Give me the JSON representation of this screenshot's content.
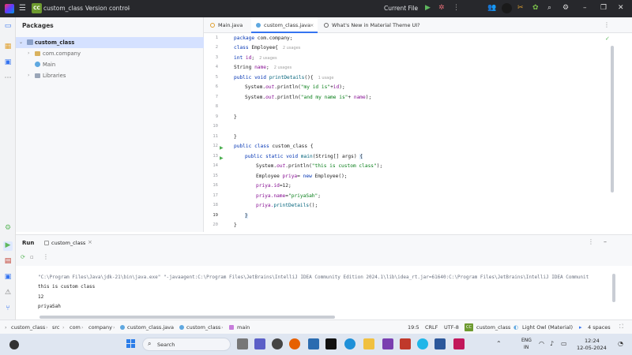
{
  "titlebar": {
    "project_badge": "CC",
    "project_name": "custom_class",
    "vcs": "Version control",
    "run_config": "Current File"
  },
  "project_panel": {
    "header": "Packages",
    "tree": [
      {
        "label": "custom_class",
        "depth": 0,
        "selected": true
      },
      {
        "label": "com.company",
        "depth": 1
      },
      {
        "label": "Main",
        "depth": 1
      },
      {
        "label": "Libraries",
        "depth": 1
      }
    ]
  },
  "tabs": [
    {
      "label": "Main.java"
    },
    {
      "label": "custom_class.java",
      "active": true
    },
    {
      "label": "What's New in Material Theme UI?"
    }
  ],
  "editor": {
    "line_numbers": [
      "1",
      "2",
      "3",
      "4",
      "5",
      "6",
      "7",
      "8",
      "9",
      "10",
      "11",
      "12",
      "13",
      "14",
      "15",
      "16",
      "17",
      "18",
      "19",
      "20"
    ],
    "hints": {
      "h2": "2 usages",
      "h3": "2 usages",
      "h4": "2 usages",
      "h5": "1 usage"
    },
    "code": {
      "l1_kw": "package",
      "l1_rest": " com.company;",
      "l2_kw": "class",
      "l2_rest": " Employee{",
      "l3_kw": "int",
      "l3_fld": " id",
      "l3_rest": ";",
      "l4_rest": "String ",
      "l4_fld": "name",
      "l4_end": ";",
      "l5_kw": "public void",
      "l5_fn": " printDetails",
      "l5_rest": "(){",
      "l6_a": "System.",
      "l6_b": "out",
      "l6_c": ".println(",
      "l6_str": "\"my id is\"",
      "l6_d": "+",
      "l6_fld": "id",
      "l6_e": ");",
      "l7_a": "System.",
      "l7_b": "out",
      "l7_c": ".println(",
      "l7_str": "\"and my name is\"",
      "l7_d": "+ ",
      "l7_fld": "name",
      "l7_e": ");",
      "l9": "}",
      "l11": "}",
      "l12_kw": "public class",
      "l12_rest": " custom_class {",
      "l13_kw": "public static void",
      "l13_fn": " main",
      "l13_rest": "(String[] args) ",
      "l13_brace": "{",
      "l14_a": "System.",
      "l14_b": "out",
      "l14_c": ".println(",
      "l14_str": "\"this is custom class\"",
      "l14_e": ");",
      "l15_a": "Employee ",
      "l15_fld": "priya",
      "l15_b": "= ",
      "l15_kw": "new",
      "l15_c": " Employee();",
      "l16_a": "priya.",
      "l16_fld": "id",
      "l16_b": "=12;",
      "l17_a": "priya.",
      "l17_fld": "name",
      "l17_b": "=",
      "l17_str": "\"priyaSah\"",
      "l17_c": ";",
      "l18_a": "priya.",
      "l18_fn": "printDetails",
      "l18_b": "();",
      "l19": "}",
      "l20": "}"
    }
  },
  "run_panel": {
    "title": "Run",
    "tab": "custom_class",
    "console": [
      "\"C:\\Program Files\\Java\\jdk-21\\bin\\java.exe\" \"-javaagent:C:\\Program Files\\JetBrains\\IntelliJ IDEA Community Edition 2024.1\\lib\\idea_rt.jar=61640:C:\\Program Files\\JetBrains\\IntelliJ IDEA Communit",
      "this is custom class",
      "12",
      "priyaSah"
    ]
  },
  "statusbar": {
    "breadcrumb": [
      "custom_class",
      "src",
      "com",
      "company",
      "custom_class.java",
      "custom_class",
      "main"
    ],
    "position": "19:5",
    "line_sep": "CRLF",
    "encoding": "UTF-8",
    "badge": "CC",
    "project": "custom_class",
    "theme": "Light Owl (Material)",
    "indent": "4 spaces"
  },
  "taskbar": {
    "search_placeholder": "Search",
    "lang": "ENG",
    "region": "IN",
    "time": "12:24",
    "date": "12-05-2024"
  },
  "colors": {
    "accent": "#3574f0",
    "keyword": "#0033b3",
    "string": "#067d17",
    "field": "#871094"
  }
}
